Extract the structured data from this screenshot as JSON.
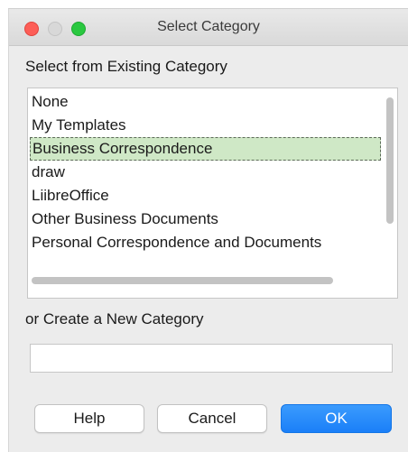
{
  "window": {
    "title": "Select Category",
    "colors": {
      "close": "#fd5e57",
      "minimize": "#d8d8d8",
      "maximize": "#2ac840",
      "accent": "#1a7ff8",
      "selection": "#cfe8c6"
    }
  },
  "existing": {
    "label": "Select from Existing Category",
    "items": [
      {
        "label": "None",
        "selected": false
      },
      {
        "label": "My Templates",
        "selected": false
      },
      {
        "label": "Business Correspondence",
        "selected": true
      },
      {
        "label": "draw",
        "selected": false
      },
      {
        "label": "LiibreOffice",
        "selected": false
      },
      {
        "label": "Other Business Documents",
        "selected": false
      },
      {
        "label": "Personal Correspondence and Documents",
        "selected": false
      }
    ]
  },
  "new_category": {
    "label": "or Create a New Category",
    "value": "",
    "placeholder": ""
  },
  "buttons": {
    "help": "Help",
    "cancel": "Cancel",
    "ok": "OK"
  }
}
